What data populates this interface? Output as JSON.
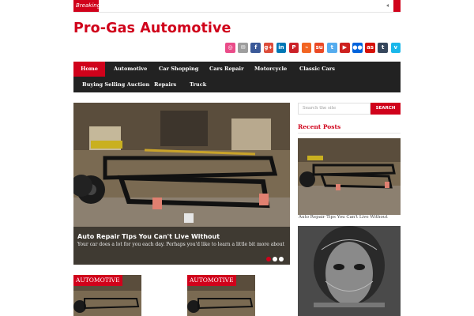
{
  "breaking": {
    "label": "Breaking"
  },
  "site": {
    "title": "Pro-Gas Automotive"
  },
  "social": [
    {
      "name": "dribbble-icon",
      "color": "#ea4c89",
      "glyph": "◎"
    },
    {
      "name": "email-icon",
      "color": "#9e9e9e",
      "glyph": "✉"
    },
    {
      "name": "facebook-icon",
      "color": "#3b5998",
      "glyph": "f"
    },
    {
      "name": "google-plus-icon",
      "color": "#dd4b39",
      "glyph": "g+"
    },
    {
      "name": "linkedin-icon",
      "color": "#0077b5",
      "glyph": "in"
    },
    {
      "name": "pinterest-icon",
      "color": "#cb2027",
      "glyph": "P"
    },
    {
      "name": "rss-icon",
      "color": "#f26522",
      "glyph": "⌁"
    },
    {
      "name": "stumbleupon-icon",
      "color": "#eb4924",
      "glyph": "su"
    },
    {
      "name": "twitter-icon",
      "color": "#55acee",
      "glyph": "t"
    },
    {
      "name": "youtube-icon",
      "color": "#cd201f",
      "glyph": "▶"
    },
    {
      "name": "flickr-icon",
      "color": "#0063dc",
      "glyph": "●●"
    },
    {
      "name": "lastfm-icon",
      "color": "#d51007",
      "glyph": "as"
    },
    {
      "name": "tumblr-icon",
      "color": "#35465c",
      "glyph": "t"
    },
    {
      "name": "vimeo-icon",
      "color": "#1ab7ea",
      "glyph": "v"
    }
  ],
  "nav": {
    "items": [
      {
        "label": "Home",
        "active": true
      },
      {
        "label": "Automotive"
      },
      {
        "label": "Car Shopping"
      },
      {
        "label": "Cars Repair"
      },
      {
        "label": "Motorcycle"
      },
      {
        "label": "Classic Cars"
      },
      {
        "label": "Buying Selling Auction"
      },
      {
        "label": "Repairs"
      },
      {
        "label": "Truck"
      }
    ]
  },
  "slider": {
    "title": "Auto Repair Tips You Can't Live Without",
    "excerpt": "Your car does a lot for you each day. Perhaps you'd like to learn a little bit more about",
    "dots": 3,
    "active_dot": 0
  },
  "sidebar": {
    "search_placeholder": "Search the site",
    "search_button": "SEARCH",
    "recent_heading": "Recent Posts",
    "recent_title": "Auto Repair Tips You Can't Live Without"
  },
  "posts": [
    {
      "category": "AUTOMOTIVE"
    },
    {
      "category": "AUTOMOTIVE"
    }
  ],
  "colors": {
    "accent": "#d0021b",
    "nav_bg": "#222222"
  }
}
